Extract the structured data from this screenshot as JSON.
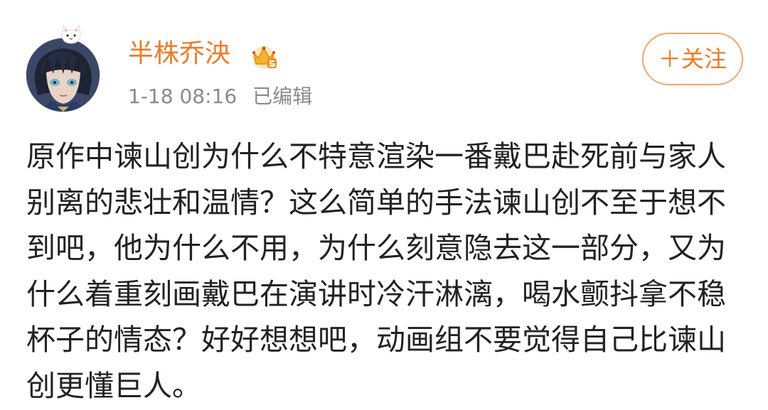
{
  "post": {
    "author": {
      "name": "半株乔泱",
      "avatar_icon": "avatar-anime-boy-icon",
      "avatar_badge_icon": "cat-ears-badge-icon",
      "vip_icon": "crown-vip-icon"
    },
    "meta": {
      "timestamp": "1-18 08:16",
      "edited_label": "已编辑"
    },
    "follow_button": {
      "label": "＋关注"
    },
    "content": "原作中谏山创为什么不特意渲染一番戴巴赴死前与家人别离的悲壮和温情？这么简单的手法谏山创不至于想不到吧，他为什么不用，为什么刻意隐去这一部分，又为什么着重刻画戴巴在演讲时冷汗淋漓，喝水颤抖拿不稳杯子的情态？好好想想吧，动画组不要觉得自己比谏山创更懂巨人。"
  },
  "colors": {
    "accent": "#f27a25",
    "button_border": "#f4a56a",
    "meta_text": "#8a8a8a",
    "body_text": "#222222"
  }
}
